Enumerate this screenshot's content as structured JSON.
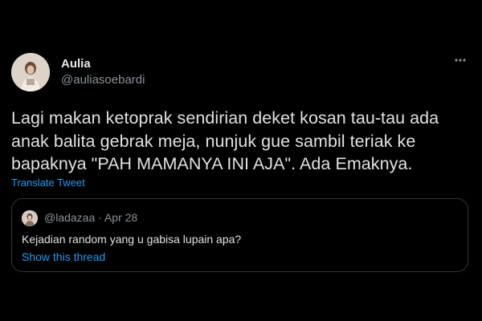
{
  "author": {
    "name": "Aulia",
    "handle": "@auliasoebardi",
    "avatar_icon": "profile-photo-icon"
  },
  "tweet": {
    "lines": [
      "Lagi makan ketoprak sendirian deket kosan tau-tau ada",
      "anak balita gebrak meja, nunjuk gue sambil teriak ke",
      "bapaknya \"PAH MAMANYA INI AJA\". Ada Emaknya."
    ],
    "translate_label": "Translate Tweet"
  },
  "quoted": {
    "handle": "@ladazaa",
    "separator": "·",
    "date": "Apr 28",
    "text": "Kejadian random yang u gabisa lupain apa?",
    "show_thread_label": "Show this thread",
    "avatar_icon": "profile-photo-icon"
  },
  "menu_icon": "more-horizontal-icon",
  "colors": {
    "background": "#000000",
    "link": "#1d9bf0",
    "muted": "#8b9197",
    "text": "#e1e1e1",
    "border": "#2f3336"
  }
}
